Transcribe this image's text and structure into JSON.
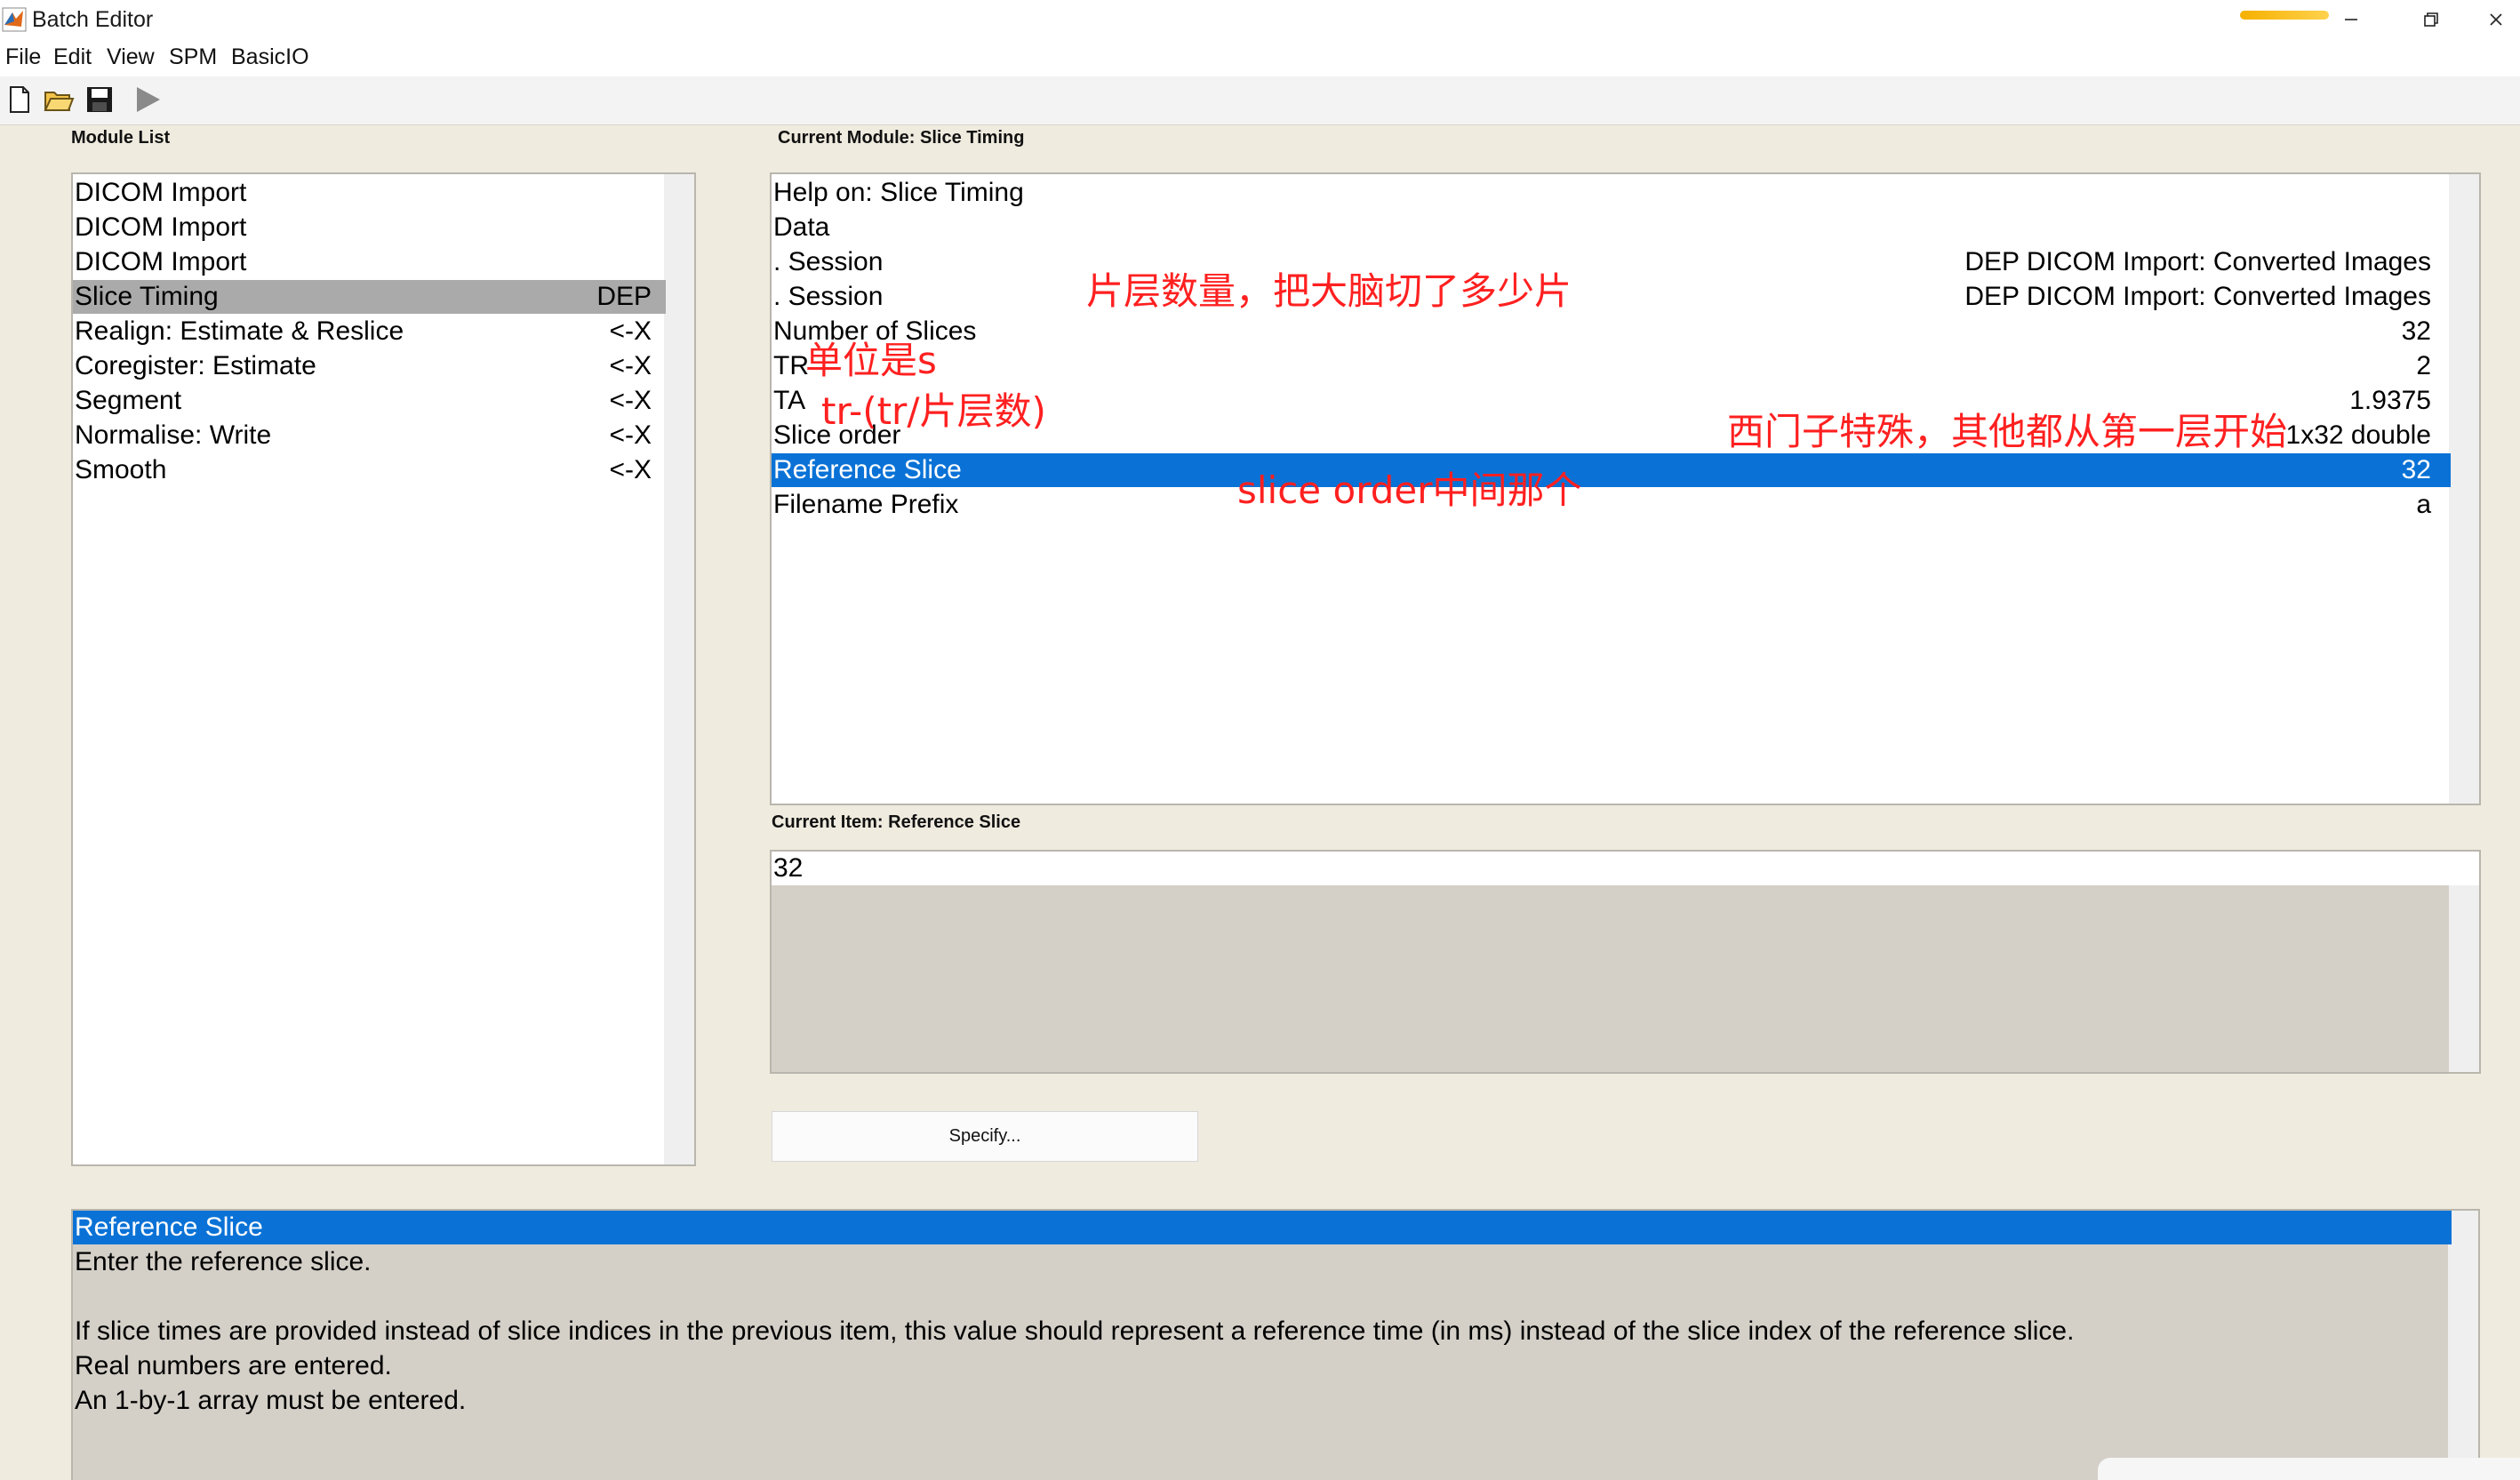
{
  "window": {
    "title": "Batch Editor"
  },
  "menu": [
    "File",
    "Edit",
    "View",
    "SPM",
    "BasicIO"
  ],
  "labels": {
    "module_list": "Module List",
    "current_module": "Current Module: Slice Timing",
    "current_item": "Current Item: Reference Slice",
    "specify": "Specify..."
  },
  "modules": [
    {
      "label": "DICOM Import",
      "tag": ""
    },
    {
      "label": "DICOM Import",
      "tag": ""
    },
    {
      "label": "DICOM Import",
      "tag": ""
    },
    {
      "label": "Slice Timing",
      "tag": "DEP"
    },
    {
      "label": "Realign: Estimate & Reslice",
      "tag": "<-X"
    },
    {
      "label": "Coregister: Estimate",
      "tag": "<-X"
    },
    {
      "label": "Segment",
      "tag": "<-X"
    },
    {
      "label": "Normalise: Write",
      "tag": "<-X"
    },
    {
      "label": "Smooth",
      "tag": "<-X"
    }
  ],
  "items": [
    {
      "label": "Help on: Slice Timing",
      "value": ""
    },
    {
      "label": "Data",
      "value": ""
    },
    {
      "label": " . Session",
      "value": "DEP DICOM Import: Converted Images"
    },
    {
      "label": " . Session",
      "value": "DEP DICOM Import: Converted Images"
    },
    {
      "label": "Number of Slices",
      "value": "32"
    },
    {
      "label": "TR",
      "value": "2"
    },
    {
      "label": "TA",
      "value": "1.9375"
    },
    {
      "label": "Slice order",
      "value": "1x32 double"
    },
    {
      "label": "Reference Slice",
      "value": "32"
    },
    {
      "label": "Filename Prefix",
      "value": "a"
    }
  ],
  "current_value": "32",
  "help": {
    "title": "Reference Slice",
    "lines": [
      "Enter the reference slice.",
      "",
      "If slice times are provided instead of slice indices in the previous item, this value should represent a reference time (in ms) instead of the slice index of the reference slice.",
      "Real numbers are entered.",
      "An 1-by-1 array must be entered."
    ]
  },
  "annotations": {
    "slices_note": "片层数量，把大脑切了多少片",
    "tr_note": "单位是s",
    "ta_note": "tr-(tr/片层数)",
    "order_note": "西门子特殊，其他都从第一层开始",
    "ref_note": "slice order中间那个"
  },
  "colors": {
    "selection": "#0a72d6",
    "annotation": "#ff2020",
    "module_selected": "#aaaaaa"
  }
}
